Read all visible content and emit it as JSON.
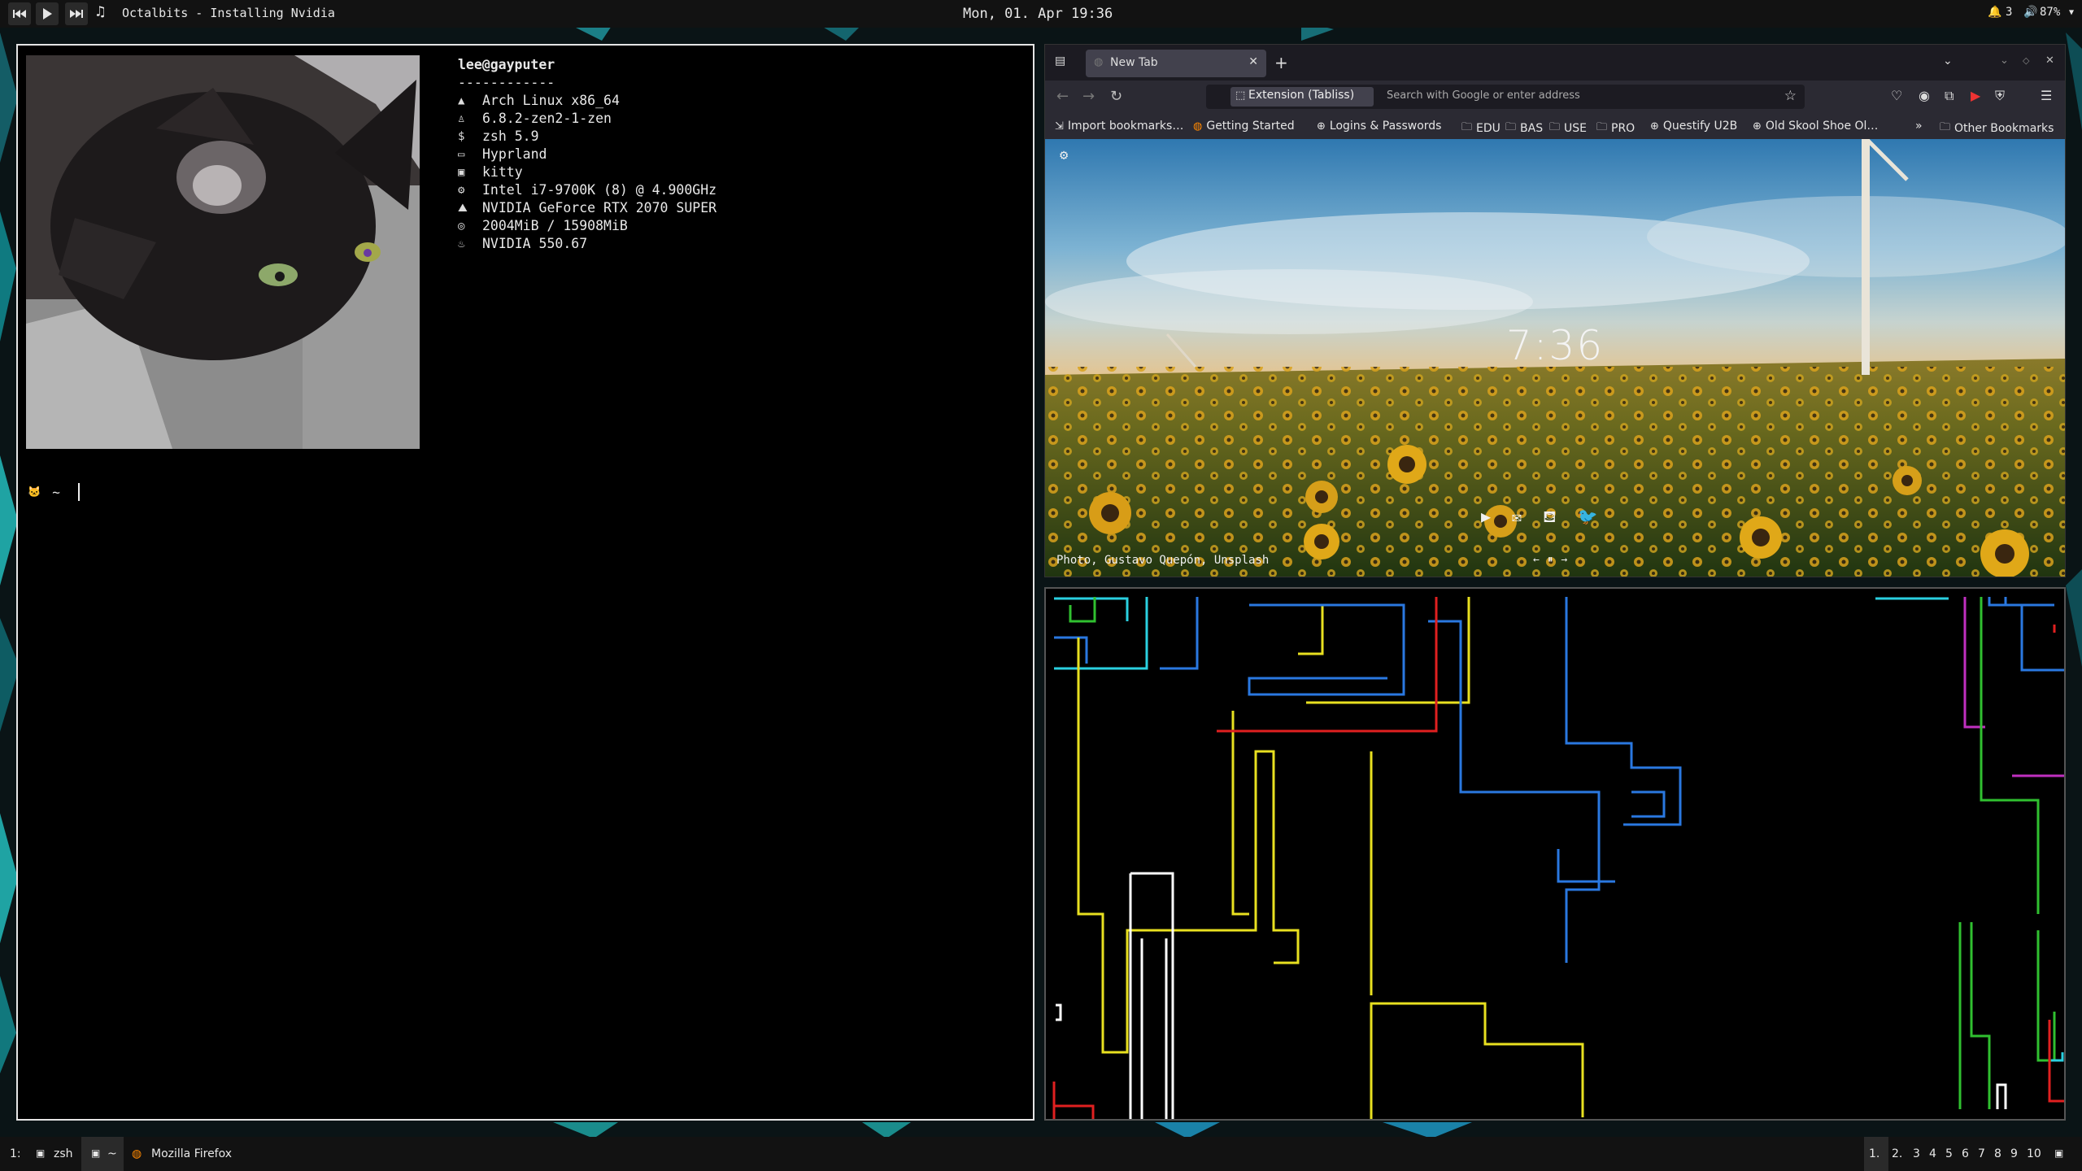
{
  "topbar": {
    "prev_icon": "skip-previous-icon",
    "play_icon": "play-icon",
    "next_icon": "skip-next-icon",
    "note_icon": "music-note-icon",
    "now_playing": "Octalbits - Installing Nvidia",
    "clock": "Mon, 01. Apr  19:36",
    "notifications": "3",
    "volume": "87%"
  },
  "terminal": {
    "user_host": "lee@gayputer",
    "separator": "------------",
    "rows": [
      {
        "icon": "arch-icon",
        "value": "Arch Linux x86_64"
      },
      {
        "icon": "penguin-icon",
        "value": "6.8.2-zen2-1-zen"
      },
      {
        "icon": "dollar-icon",
        "value": "zsh 5.9"
      },
      {
        "icon": "monitor-icon",
        "value": "Hyprland"
      },
      {
        "icon": "window-icon",
        "value": "kitty"
      },
      {
        "icon": "cpu-icon",
        "value": "Intel i7-9700K (8) @ 4.900GHz"
      },
      {
        "icon": "mountain-icon",
        "value": "NVIDIA GeForce RTX 2070 SUPER"
      },
      {
        "icon": "memory-icon",
        "value": "2004MiB / 15908MiB"
      },
      {
        "icon": "flame-icon",
        "value": "NVIDIA 550.67"
      }
    ],
    "prompt": "~"
  },
  "firefox": {
    "tab_title": "New Tab",
    "extension_label": "Extension (Tabliss)",
    "url_placeholder": "Search with Google or enter address",
    "bookmarks": {
      "import": "Import bookmarks…",
      "getting_started": "Getting Started",
      "logins": "Logins & Passwords",
      "edu": "EDU",
      "bas": "BAS",
      "use": "USE",
      "pro": "PRO",
      "questify": "Questify U2B",
      "oldskool": "Old Skool Shoe Ol…",
      "other": "Other Bookmarks"
    },
    "newtab": {
      "time": "7:36",
      "credit": "Photo, Gustavo Quepón, Unsplash"
    }
  },
  "taskbar": {
    "ws_prefix": "1:",
    "task_zsh": "zsh",
    "task_tilde": "~",
    "task_firefox": "Mozilla Firefox",
    "workspaces": [
      "1.",
      "2.",
      "3",
      "4",
      "5",
      "6",
      "7",
      "8",
      "9",
      "10"
    ]
  }
}
